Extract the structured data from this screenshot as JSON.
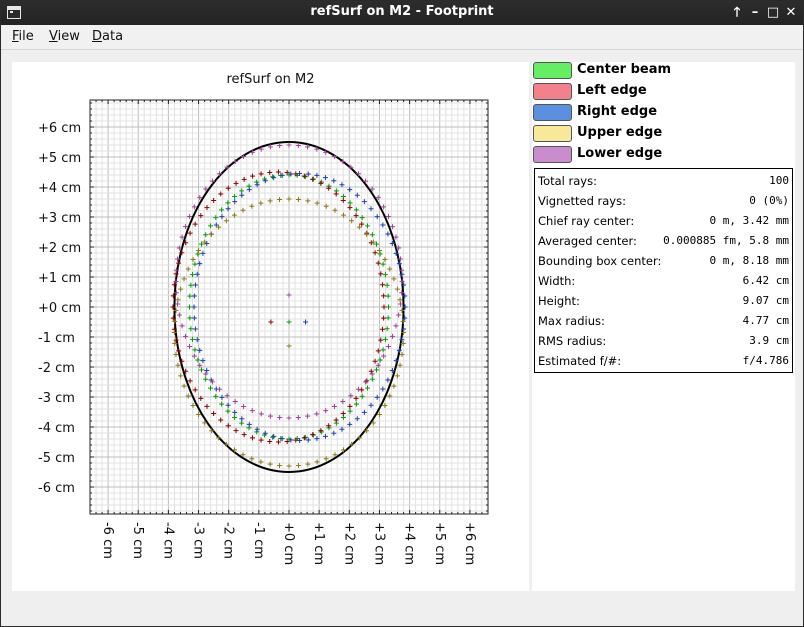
{
  "window": {
    "title": "refSurf on M2 - Footprint",
    "controls": {
      "up": "🡑",
      "minimize": "–",
      "maximize": "□",
      "close": "✕"
    }
  },
  "menu": [
    {
      "mnemonic": "F",
      "rest": "ile"
    },
    {
      "mnemonic": "V",
      "rest": "iew"
    },
    {
      "mnemonic": "D",
      "rest": "ata"
    }
  ],
  "plot": {
    "title": "refSurf on M2",
    "y_tick_labels": [
      "+6  cm",
      "+5  cm",
      "+4  cm",
      "+3  cm",
      "+2  cm",
      "+1  cm",
      "+0  cm",
      "-1  cm",
      "-2  cm",
      "-3  cm",
      "-4  cm",
      "-5  cm",
      "-6  cm"
    ],
    "x_tick_labels": [
      "-6  cm",
      "-5  cm",
      "-4  cm",
      "-3  cm",
      "-2  cm",
      "-1  cm",
      "+0  cm",
      "+1  cm",
      "+2  cm",
      "+3  cm",
      "+4  cm",
      "+5  cm",
      "+6  cm"
    ]
  },
  "legend": [
    {
      "label": "Center beam",
      "color": "#63ee63"
    },
    {
      "label": "Left edge",
      "color": "#f2818b"
    },
    {
      "label": "Right edge",
      "color": "#5b8fe0"
    },
    {
      "label": "Upper edge",
      "color": "#f8e89a"
    },
    {
      "label": "Lower edge",
      "color": "#c98ccd"
    }
  ],
  "stats": [
    {
      "name": "Total rays:",
      "value": "100"
    },
    {
      "name": "Vignetted rays:",
      "value": "0 (0%)"
    },
    {
      "name": "Chief ray center:",
      "value": "0 m, 3.42 mm"
    },
    {
      "name": "Averaged center:",
      "value": "0.000885 fm, 5.8 mm"
    },
    {
      "name": "Bounding box center:",
      "value": "0 m, 8.18 mm"
    },
    {
      "name": "Width:",
      "value": "6.42 cm"
    },
    {
      "name": "Height:",
      "value": "9.07 cm"
    },
    {
      "name": "Max radius:",
      "value": "4.77 cm"
    },
    {
      "name": "RMS radius:",
      "value": "3.9 cm"
    },
    {
      "name": "Estimated f/#:",
      "value": "f/4.786"
    }
  ],
  "chart_data": {
    "type": "scatter",
    "title": "refSurf on M2",
    "xlabel": "",
    "ylabel": "",
    "xlim": [
      -6.6,
      6.6
    ],
    "ylim": [
      -6.9,
      6.9
    ],
    "grid": true,
    "units": "cm",
    "aperture_outline": {
      "cx": 0,
      "cy": 0,
      "rx": 3.8,
      "ry": 5.5
    },
    "series": [
      {
        "name": "Center beam",
        "color": "#00a000",
        "ring": {
          "cx": 0,
          "cy": 0,
          "rx": 3.3,
          "ry": 4.4
        },
        "chief": [
          0,
          -0.5
        ]
      },
      {
        "name": "Left edge",
        "color": "#8b0000",
        "ring": {
          "cx": -0.35,
          "cy": 0,
          "rx": 3.5,
          "ry": 4.5
        },
        "chief": [
          -0.6,
          -0.5
        ]
      },
      {
        "name": "Right edge",
        "color": "#1a3fb0",
        "ring": {
          "cx": 0.35,
          "cy": 0,
          "rx": 3.5,
          "ry": 4.45
        },
        "chief": [
          0.55,
          -0.5
        ]
      },
      {
        "name": "Upper edge",
        "color": "#8a7a10",
        "ring": {
          "cx": 0,
          "cy": -0.85,
          "rx": 3.8,
          "ry": 4.45
        },
        "chief": [
          0,
          -1.3
        ]
      },
      {
        "name": "Lower edge",
        "color": "#a0409a",
        "ring": {
          "cx": 0,
          "cy": 0.85,
          "rx": 3.75,
          "ry": 4.55
        },
        "chief": [
          0,
          0.4
        ]
      }
    ]
  }
}
